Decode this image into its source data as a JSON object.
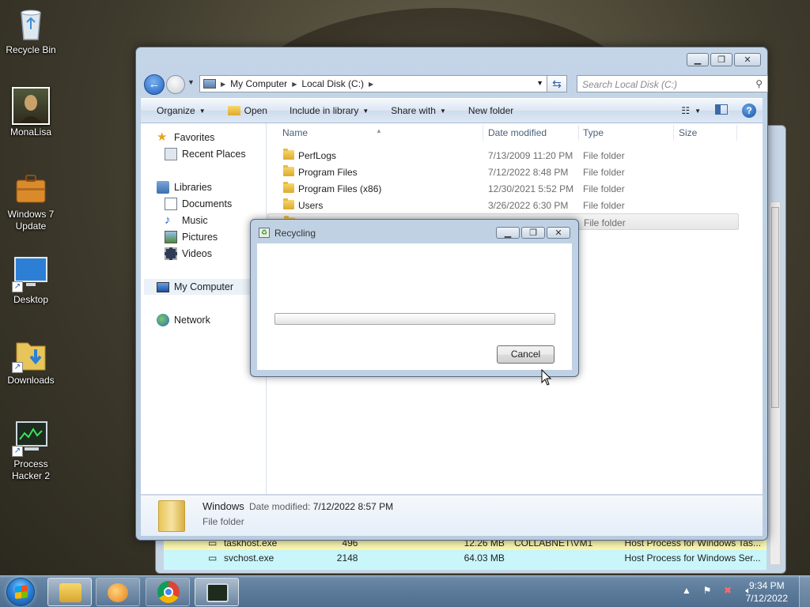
{
  "desktop": {
    "icons": [
      {
        "label": "Recycle Bin"
      },
      {
        "label": "MonaLisa"
      },
      {
        "label": "Windows 7 Update"
      },
      {
        "label": "Desktop"
      },
      {
        "label": "Downloads"
      },
      {
        "label": "Process Hacker 2"
      }
    ]
  },
  "explorer": {
    "address": {
      "crumbs": [
        "My Computer",
        "Local Disk (C:)"
      ]
    },
    "search": {
      "placeholder": "Search Local Disk (C:)"
    },
    "toolbar": {
      "organize": "Organize",
      "open": "Open",
      "include_in_library": "Include in library",
      "share_with": "Share with",
      "new_folder": "New folder"
    },
    "nav": {
      "favorites": "Favorites",
      "recent_places": "Recent Places",
      "libraries": "Libraries",
      "documents": "Documents",
      "music": "Music",
      "pictures": "Pictures",
      "videos": "Videos",
      "my_computer": "My Computer",
      "network": "Network"
    },
    "columns": {
      "name": "Name",
      "date_modified": "Date modified",
      "type": "Type",
      "size": "Size"
    },
    "files": [
      {
        "name": "PerfLogs",
        "date": "7/13/2009 11:20 PM",
        "type": "File folder"
      },
      {
        "name": "Program Files",
        "date": "7/12/2022 8:48 PM",
        "type": "File folder"
      },
      {
        "name": "Program Files (x86)",
        "date": "12/30/2021 5:52 PM",
        "type": "File folder"
      },
      {
        "name": "Users",
        "date": "3/26/2022 6:30 PM",
        "type": "File folder"
      },
      {
        "name": "",
        "date": "",
        "type": "File folder"
      }
    ],
    "details": {
      "name": "Windows",
      "date_label": "Date modified:",
      "date_value": "7/12/2022 8:57 PM",
      "type": "File folder"
    }
  },
  "dialog": {
    "title": "Recycling",
    "progress": 0,
    "cancel_label": "Cancel"
  },
  "background_window": {
    "rows": [
      {
        "name": "taskhost.exe",
        "pid": "496",
        "mem": "12.26 MB",
        "user": "COLLABNET\\VM1",
        "desc": "Host Process for Windows Tas..."
      },
      {
        "name": "svchost.exe",
        "pid": "2148",
        "mem": "64.03 MB",
        "user": "",
        "desc": "Host Process for Windows Ser..."
      }
    ]
  },
  "taskbar": {
    "clock_time": "9:34 PM",
    "clock_date": "7/12/2022"
  }
}
